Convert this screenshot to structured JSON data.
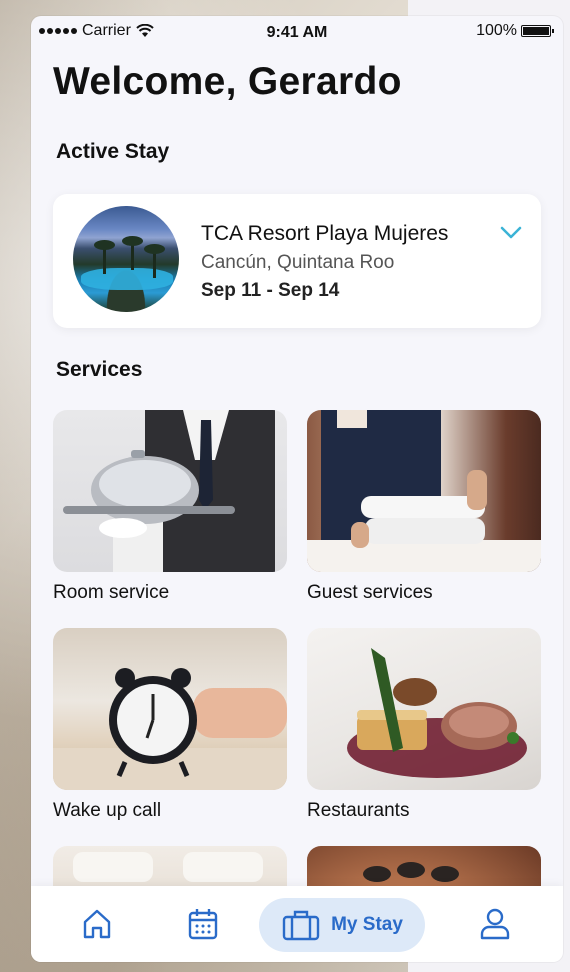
{
  "status_bar": {
    "carrier": "Carrier",
    "time": "9:41 AM",
    "battery": "100%",
    "battery_level": 1.0
  },
  "welcome": "Welcome, Gerardo",
  "active_stay": {
    "title": "Active Stay",
    "resort_name": "TCA Resort Playa Mujeres",
    "location": "Cancún, Quintana Roo",
    "dates": "Sep 11 - Sep 14",
    "expand_icon": "chevron-down-icon"
  },
  "services": {
    "title": "Services",
    "items": [
      {
        "label": "Room service",
        "image": "waiter-cloche-photo"
      },
      {
        "label": "Guest services",
        "image": "housekeeper-towels-photo"
      },
      {
        "label": "Wake up call",
        "image": "alarm-clock-photo"
      },
      {
        "label": "Restaurants",
        "image": "plated-dish-photo"
      },
      {
        "label": "",
        "image": "bedroom-photo"
      },
      {
        "label": "",
        "image": "spa-stones-photo"
      }
    ]
  },
  "bottom_nav": {
    "items": [
      {
        "icon": "home-icon"
      },
      {
        "icon": "calendar-icon"
      },
      {
        "icon": "suitcase-icon",
        "label": "My Stay",
        "active": true
      },
      {
        "icon": "user-icon"
      }
    ]
  },
  "colors": {
    "accent": "#2a6bc9",
    "accent_bg": "#dde9f8",
    "chevron": "#3bb3d6",
    "background": "#f6f6fb"
  }
}
